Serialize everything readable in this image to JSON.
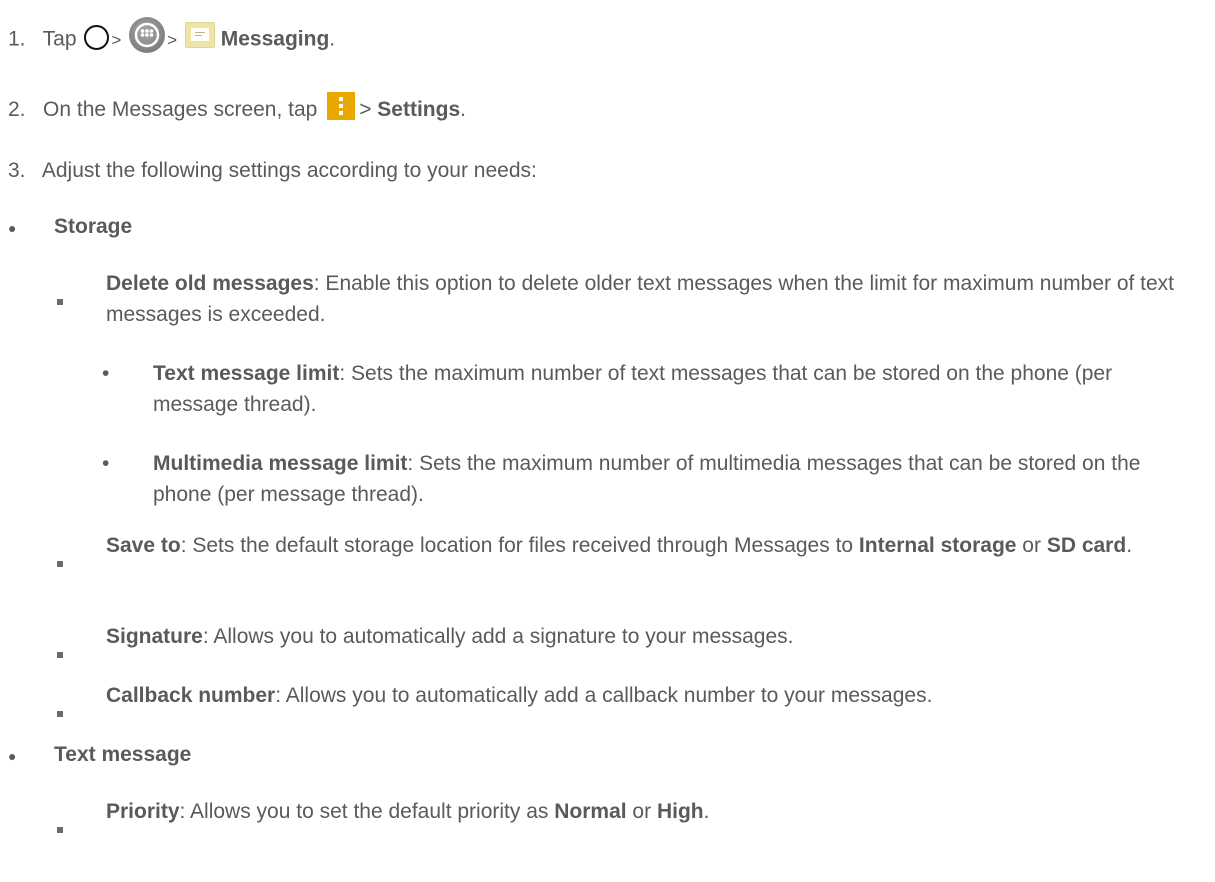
{
  "step1": {
    "num": "1.",
    "tap": "Tap",
    "sep1": ">",
    "sep2": ">",
    "app": "Messaging",
    "end": ".",
    "icons": [
      "home-icon",
      "apps-icon",
      "messaging-icon"
    ]
  },
  "step2": {
    "num": "2.",
    "pre": "On the Messages screen, tap",
    "sep": ">",
    "target": "Settings",
    "end": ".",
    "icon": "menu-icon"
  },
  "step3": {
    "num": "3.",
    "text": "Adjust the following settings according to your needs:"
  },
  "storage": {
    "bullet": "●",
    "title": "Storage",
    "delete_old": {
      "label": "Delete old messages",
      "desc": ": Enable this option to delete older text messages when the limit for maximum number of text messages is exceeded."
    },
    "text_limit": {
      "bullet": "•",
      "label": "Text message limit",
      "desc": ": Sets the maximum number of text messages that can be stored on the phone (per message thread)."
    },
    "mms_limit": {
      "bullet": "•",
      "label": "Multimedia message limit",
      "desc": ": Sets the maximum number of multimedia messages that can be stored on the phone (per message thread)."
    },
    "save_to": {
      "label": "Save to",
      "desc1": ": Sets the default storage location for files received through Messages to ",
      "opt1": "Internal storage",
      "or": " or ",
      "opt2": "SD card",
      "end": "."
    },
    "signature": {
      "label": "Signature",
      "desc": ": Allows you to automatically add a signature to your messages."
    },
    "callback": {
      "label": "Callback number",
      "desc": ": Allows you to automatically add a callback number to your messages."
    }
  },
  "text_message": {
    "bullet": "●",
    "title": "Text message",
    "priority": {
      "label": "Priority",
      "desc1": ": Allows you to set the default priority as ",
      "opt1": "Normal",
      "or": " or ",
      "opt2": "High",
      "end": "."
    }
  }
}
